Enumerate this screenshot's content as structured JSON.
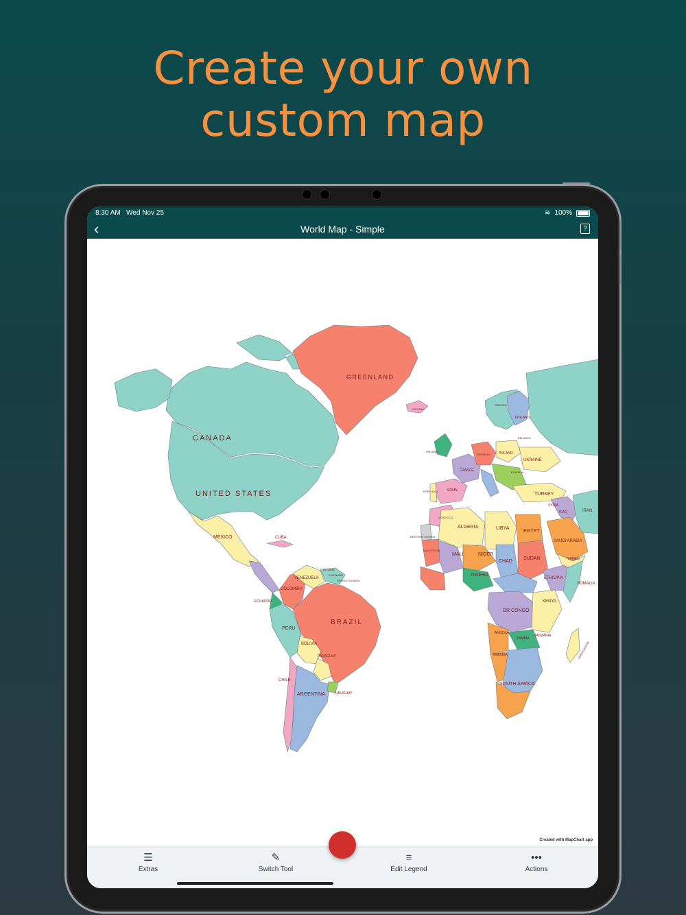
{
  "headline": {
    "line1": "Create your own",
    "line2": "custom map"
  },
  "colors": {
    "accent": "#f7903f",
    "bar": "#0b4a4c",
    "record": "#d12e2e"
  },
  "status": {
    "time": "8:30 AM",
    "date": "Wed Nov 25",
    "battery": "100%"
  },
  "nav": {
    "back_icon": "chevron-left-icon",
    "title": "World Map - Simple",
    "help_label": "?"
  },
  "map": {
    "labels": {
      "greenland": "GREENLAND",
      "canada": "CANADA",
      "usa": "UNITED STATES",
      "mexico": "MEXICO",
      "cuba": "CUBA",
      "venezuela": "VENEZUELA",
      "colombia": "COLOMBIA",
      "ecuador": "ECUADOR",
      "peru": "PERU",
      "brazil": "BRAZIL",
      "bolivia": "BOLIVIA",
      "paraguay": "PARAGUAY",
      "chile": "CHILE",
      "argentina": "ARGENTINA",
      "uruguay": "URUGUAY",
      "guyana": "GUYANA",
      "suriname": "SURINAME",
      "french_guiana": "FRENCH GUIANA",
      "iceland": "ICELAND",
      "ireland": "IRELAND",
      "france": "FRANCE",
      "spain": "SPAIN",
      "portugal": "PORTUGAL",
      "germany": "GERMANY",
      "poland": "POLAND",
      "ukraine": "UKRAINE",
      "romania": "ROMANIA",
      "sweden": "SWEDEN",
      "finland": "FINLAND",
      "belarus": "BELARUS",
      "turkey": "TURKEY",
      "syria": "SYRIA",
      "iraq": "IRAQ",
      "iran": "IRAN",
      "morocco": "MOROCCO",
      "western_sahara": "WESTERN SAHARA",
      "algeria": "ALGERIA",
      "libya": "LIBYA",
      "egypt": "EGYPT",
      "mauritania": "MAURITANIA",
      "mali": "MALI",
      "niger": "NIGER",
      "chad": "CHAD",
      "sudan": "SUDAN",
      "saudi": "SAUDI ARABIA",
      "yemen": "YEMEN",
      "nigeria": "NIGERIA",
      "ethiopia": "ETHIOPIA",
      "somalia": "SOMALIA",
      "kenya": "KENYA",
      "drc": "DR CONGO",
      "tanzania": "TANZANIA",
      "angola": "ANGOLA",
      "zambia": "ZAMBIA",
      "namibia": "NAMIBIA",
      "south_africa": "SOUTH AFRICA",
      "madagascar": "MADAGASCAR"
    }
  },
  "credit": "Created with MapChart app",
  "toolbar": {
    "extras": "Extras",
    "switch_tool": "Switch Tool",
    "edit_legend": "Edit Legend",
    "actions": "Actions"
  }
}
